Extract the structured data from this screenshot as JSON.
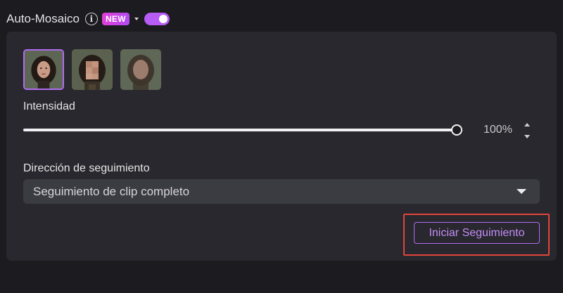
{
  "header": {
    "title": "Auto-Mosaico",
    "info_icon": "info-icon",
    "badge": "NEW",
    "toggle_on": true
  },
  "thumbnails": [
    {
      "name": "face-sharp",
      "selected": true
    },
    {
      "name": "face-pixelated",
      "selected": false
    },
    {
      "name": "face-blurred",
      "selected": false
    }
  ],
  "intensity": {
    "label": "Intensidad",
    "value_text": "100%",
    "value": 100
  },
  "tracking": {
    "label": "Dirección de seguimiento",
    "selected": "Seguimiento de clip completo"
  },
  "actions": {
    "start_label": "Iniciar Seguimiento"
  },
  "colors": {
    "accent": "#b75cf5",
    "highlight": "#e1453a",
    "panel": "#28282e",
    "background": "#1b1b20"
  }
}
